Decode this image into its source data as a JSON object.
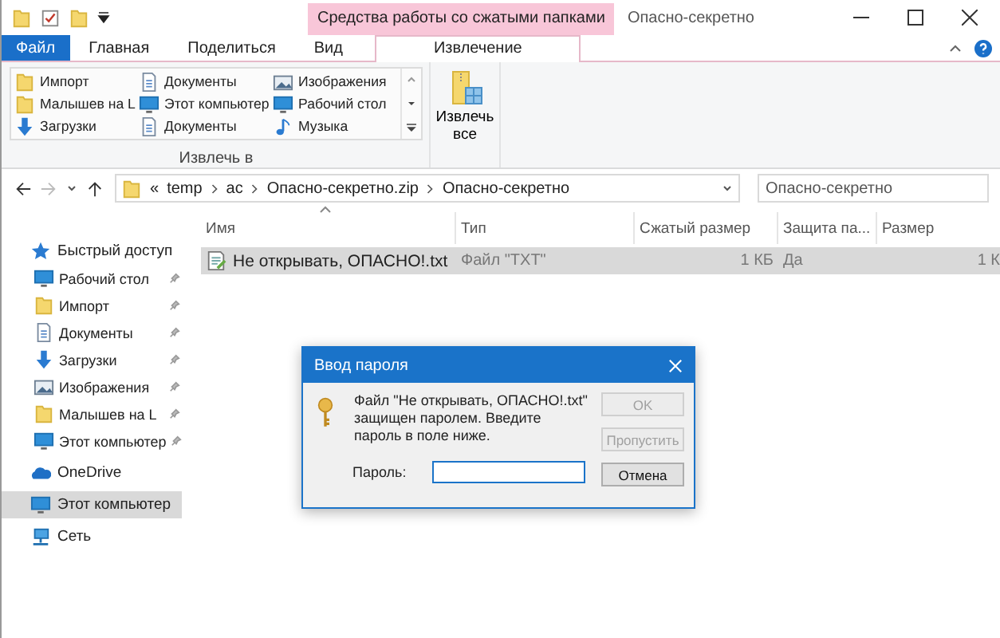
{
  "window": {
    "title": "Опасно-секретно",
    "context_tab": "Средства работы со сжатыми папками"
  },
  "ribbon_tabs": [
    {
      "label": "Файл",
      "kind": "file",
      "selected": false
    },
    {
      "label": "Главная",
      "kind": "tab",
      "selected": false
    },
    {
      "label": "Поделиться",
      "kind": "tab",
      "selected": false
    },
    {
      "label": "Вид",
      "kind": "tab",
      "selected": false
    },
    {
      "label": "Извлечение",
      "kind": "tab",
      "selected": true
    }
  ],
  "extract_to": {
    "label": "Извлечь в",
    "items": [
      {
        "label": "Импорт",
        "kind": "folder"
      },
      {
        "label": "Малышев на L",
        "kind": "folder"
      },
      {
        "label": "Загрузки",
        "kind": "download"
      },
      {
        "label": "Документы",
        "kind": "document"
      },
      {
        "label": "Этот компьютер",
        "kind": "computer"
      },
      {
        "label": "Документы",
        "kind": "document"
      },
      {
        "label": "Изображения",
        "kind": "pictures"
      },
      {
        "label": "Рабочий стол",
        "kind": "desktop"
      },
      {
        "label": "Музыка",
        "kind": "music"
      }
    ]
  },
  "extract_all": "Извлечь все",
  "address": {
    "overflow_mark": "«",
    "crumbs": [
      "temp",
      "ac",
      "Опасно-секретно.zip",
      "Опасно-секретно"
    ]
  },
  "search": {
    "placeholder": "Опасно-секретно"
  },
  "nav": [
    {
      "label": "Быстрый доступ",
      "kind": "star",
      "selected": false,
      "children": [
        {
          "label": "Рабочий стол",
          "kind": "desktop",
          "pinned": true
        },
        {
          "label": "Импорт",
          "kind": "folder",
          "pinned": true
        },
        {
          "label": "Документы",
          "kind": "document",
          "pinned": true
        },
        {
          "label": "Загрузки",
          "kind": "download",
          "pinned": true
        },
        {
          "label": "Изображения",
          "kind": "pictures",
          "pinned": true
        },
        {
          "label": "Малышев на L",
          "kind": "folder",
          "pinned": true
        },
        {
          "label": "Этот компьютер",
          "kind": "computer",
          "pinned": true
        }
      ]
    },
    {
      "label": "OneDrive",
      "kind": "cloud",
      "selected": false
    },
    {
      "label": "Этот компьютер",
      "kind": "computer",
      "selected": true
    },
    {
      "label": "Сеть",
      "kind": "network",
      "selected": false
    }
  ],
  "table": {
    "columns": [
      {
        "label": "Имя",
        "sorted": true
      },
      {
        "label": "Тип",
        "sorted": false
      },
      {
        "label": "Сжатый размер",
        "sorted": false
      },
      {
        "label": "Защита па...",
        "sorted": false
      },
      {
        "label": "Размер",
        "sorted": false
      }
    ],
    "rows": [
      {
        "selected": true,
        "cells": [
          "Не открывать, ОПАСНО!.txt",
          "Файл \"TXT\"",
          "1 КБ",
          "Да",
          "1 К"
        ]
      }
    ]
  },
  "dialog": {
    "title": "Ввод пароля",
    "message": "Файл \"Не открывать, ОПАСНО!.txt\" защищен паролем. Введите пароль в поле ниже.",
    "field_label": "Пароль:",
    "buttons": [
      {
        "label": "OK",
        "disabled": true
      },
      {
        "label": "Пропустить",
        "disabled": true
      },
      {
        "label": "Отмена",
        "disabled": false
      }
    ]
  }
}
